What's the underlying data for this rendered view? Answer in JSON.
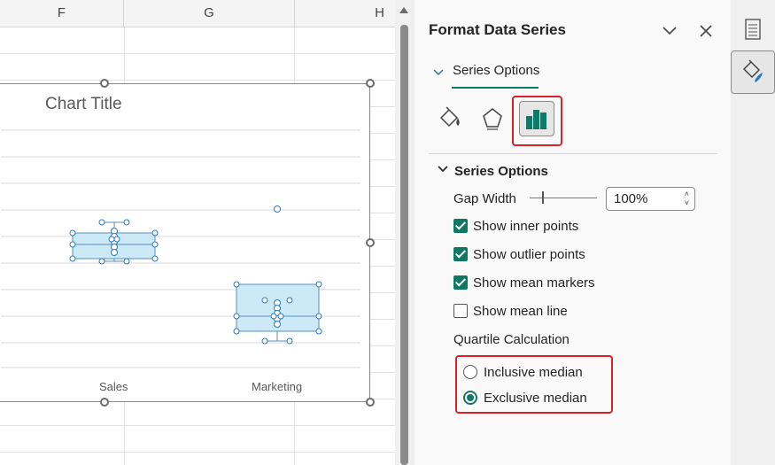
{
  "sheet": {
    "columns": [
      "F",
      "G",
      "H"
    ]
  },
  "chart": {
    "title": "Chart Title",
    "categories": [
      "Sales",
      "Marketing"
    ]
  },
  "chart_data": {
    "type": "box",
    "categories": [
      "Sales",
      "Marketing"
    ],
    "series": [
      {
        "values": []
      }
    ],
    "title": "Chart Title",
    "xlabel": "",
    "ylabel": "",
    "grid": true,
    "legend": "none"
  },
  "pane": {
    "title": "Format Data Series",
    "tab_label": "Series Options",
    "section_label": "Series Options",
    "gap_width_label": "Gap Width",
    "gap_width_value": "100%",
    "show_inner_points": "Show inner points",
    "show_outlier_points": "Show outlier points",
    "show_mean_markers": "Show mean markers",
    "show_mean_line": "Show mean line",
    "quartile_label": "Quartile Calculation",
    "inclusive_median": "Inclusive median",
    "exclusive_median": "Exclusive median"
  },
  "colors": {
    "accent": "#117865",
    "highlight": "#d9212a",
    "box_fill": "#cce9f7",
    "box_stroke": "#5a8fb8"
  },
  "icons": {
    "fill_line": "paint-bucket-icon",
    "effects": "pentagon-icon",
    "series_options": "bar-chart-icon",
    "rail_top": "document-icon",
    "rail_paint": "paintbrush-icon"
  }
}
